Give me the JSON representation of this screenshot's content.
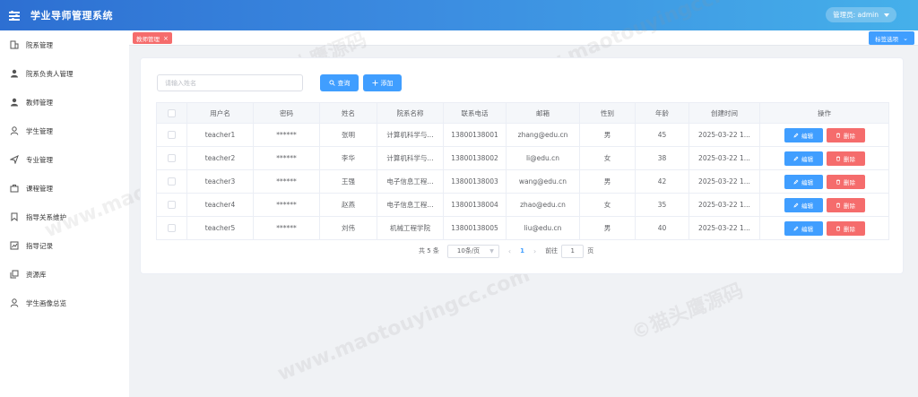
{
  "app": {
    "title": "学业导师管理系统",
    "user_menu": "管理员: admin"
  },
  "sidebar": {
    "items": [
      {
        "label": "院系管理",
        "icon": "building-icon"
      },
      {
        "label": "院系负责人管理",
        "icon": "user-solid-icon"
      },
      {
        "label": "教师管理",
        "icon": "user-solid-icon"
      },
      {
        "label": "学生管理",
        "icon": "user-outline-icon"
      },
      {
        "label": "专业管理",
        "icon": "paper-plane-icon"
      },
      {
        "label": "课程管理",
        "icon": "briefcase-icon"
      },
      {
        "label": "指导关系维护",
        "icon": "bookmark-icon"
      },
      {
        "label": "指导记录",
        "icon": "chart-icon"
      },
      {
        "label": "资源库",
        "icon": "copy-icon"
      },
      {
        "label": "学生画像总览",
        "icon": "user-outline-icon"
      }
    ]
  },
  "tags": {
    "active_label": "教师管理",
    "close": "×",
    "options_label": "标签选项"
  },
  "toolbar": {
    "search_placeholder": "请输入姓名",
    "search_label": "查询",
    "add_label": "添加"
  },
  "table": {
    "columns": [
      "用户名",
      "密码",
      "姓名",
      "院系名称",
      "联系电话",
      "邮箱",
      "性别",
      "年龄",
      "创建时间",
      "操作"
    ],
    "rows": [
      {
        "username": "teacher1",
        "password": "******",
        "name": "张明",
        "dept": "计算机科学与...",
        "phone": "13800138001",
        "email": "zhang@edu.cn",
        "gender": "男",
        "age": "45",
        "created": "2025-03-22 1..."
      },
      {
        "username": "teacher2",
        "password": "******",
        "name": "李华",
        "dept": "计算机科学与...",
        "phone": "13800138002",
        "email": "li@edu.cn",
        "gender": "女",
        "age": "38",
        "created": "2025-03-22 1..."
      },
      {
        "username": "teacher3",
        "password": "******",
        "name": "王强",
        "dept": "电子信息工程...",
        "phone": "13800138003",
        "email": "wang@edu.cn",
        "gender": "男",
        "age": "42",
        "created": "2025-03-22 1..."
      },
      {
        "username": "teacher4",
        "password": "******",
        "name": "赵燕",
        "dept": "电子信息工程...",
        "phone": "13800138004",
        "email": "zhao@edu.cn",
        "gender": "女",
        "age": "35",
        "created": "2025-03-22 1..."
      },
      {
        "username": "teacher5",
        "password": "******",
        "name": "刘伟",
        "dept": "机械工程学院",
        "phone": "13800138005",
        "email": "liu@edu.cn",
        "gender": "男",
        "age": "40",
        "created": "2025-03-22 1..."
      }
    ],
    "edit_label": "编辑",
    "delete_label": "删除"
  },
  "pagination": {
    "total": "共 5 条",
    "page_size": "10条/页",
    "prev": "‹",
    "current_page": "1",
    "next": "›",
    "goto_prefix": "前往",
    "goto_value": "1",
    "goto_suffix": "页"
  },
  "watermark": {
    "text_cn": "©猫头鹰源码",
    "text_url": "www.maotouyingcc.com"
  },
  "colors": {
    "header_start": "#2d6fd2",
    "header_end": "#45b0ea",
    "primary": "#409eff",
    "danger": "#f56c6c"
  }
}
